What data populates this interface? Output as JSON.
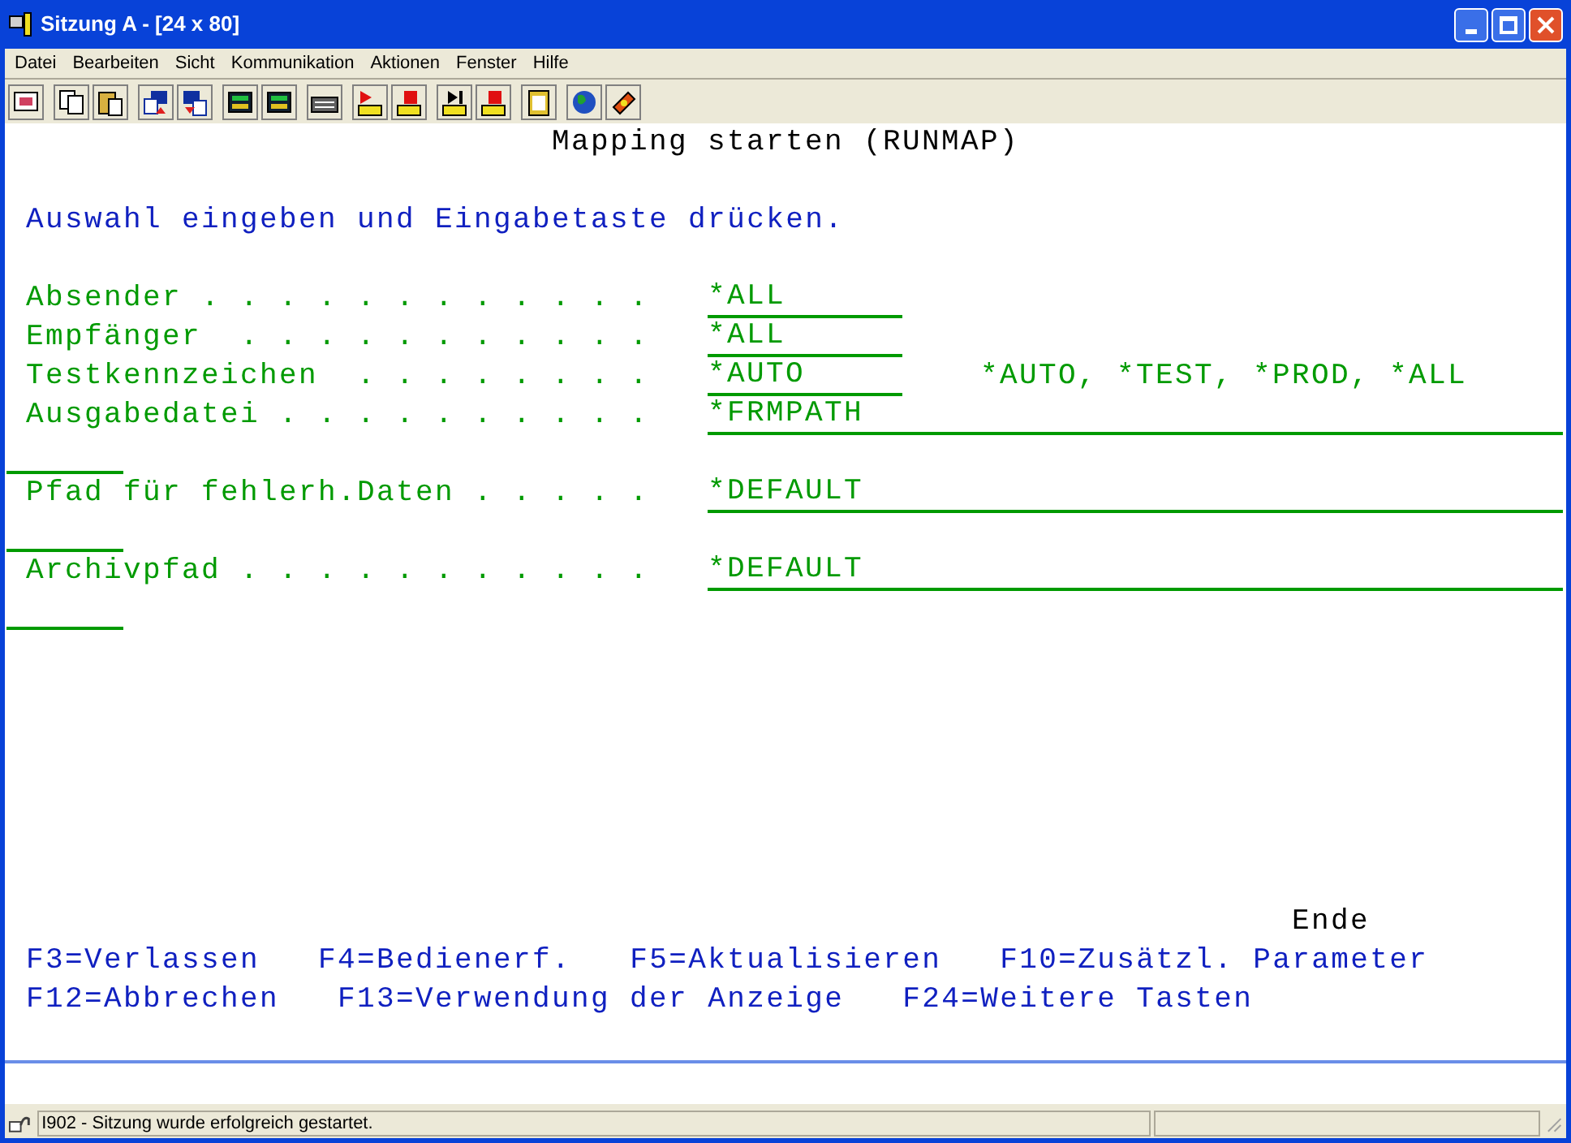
{
  "window": {
    "title": "Sitzung A - [24 x 80]"
  },
  "menu": [
    "Datei",
    "Bearbeiten",
    "Sicht",
    "Kommunikation",
    "Aktionen",
    "Fenster",
    "Hilfe"
  ],
  "screen": {
    "title": "Mapping starten (RUNMAP)",
    "instruction": "Auswahl eingeben und Eingabetaste drücken.",
    "fields": [
      {
        "label": "Absender . . . . . . . . . . . .",
        "value": "*ALL",
        "kind": "short"
      },
      {
        "label": "Empfänger  . . . . . . . . . . .",
        "value": "*ALL",
        "kind": "short"
      },
      {
        "label": "Testkennzeichen  . . . . . . . .",
        "value": "*AUTO",
        "kind": "short",
        "hint": "*AUTO, *TEST, *PROD, *ALL"
      },
      {
        "label": "Ausgabedatei . . . . . . . . . .",
        "value": "*FRMPATH",
        "kind": "long"
      },
      {
        "label": "Pfad für fehlerh.Daten . . . . .",
        "value": "*DEFAULT",
        "kind": "long"
      },
      {
        "label": "Archivpfad . . . . . . . . . . .",
        "value": "*DEFAULT",
        "kind": "long"
      }
    ],
    "more": "Ende",
    "function_keys": [
      [
        "F3=Verlassen",
        "F4=Bedienerf.",
        "F5=Aktualisieren",
        "F10=Zusätzl. Parameter"
      ],
      [
        "F12=Abbrechen",
        "F13=Verwendung der Anzeige",
        "F24=Weitere Tasten"
      ]
    ]
  },
  "status_bar": {
    "message": "I902 - Sitzung wurde erfolgreich gestartet."
  }
}
